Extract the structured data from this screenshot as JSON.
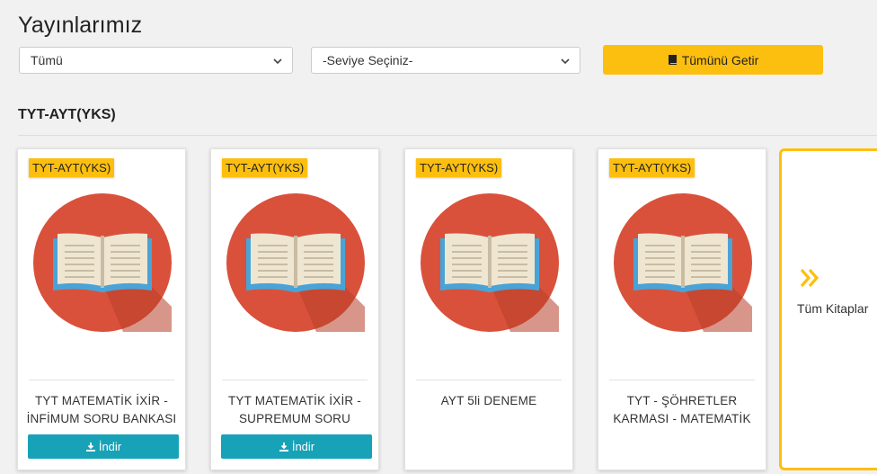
{
  "header": {
    "title": "Yayınlarımız"
  },
  "filters": {
    "category": "Tümü",
    "level": "-Seviye Seçiniz-",
    "fetch_label": "Tümünü Getir"
  },
  "section": {
    "title": "TYT-AYT(YKS)"
  },
  "books": [
    {
      "badge": "TYT-AYT(YKS)",
      "line1": "TYT MATEMATİK İXİR -",
      "line2": "İNFİMUM SORU BANKASI",
      "download": "İndir"
    },
    {
      "badge": "TYT-AYT(YKS)",
      "line1": "TYT MATEMATİK İXİR -",
      "line2": "SUPREMUM SORU",
      "download": "İndir"
    },
    {
      "badge": "TYT-AYT(YKS)",
      "line1": "AYT 5li DENEME",
      "line2": "",
      "download": ""
    },
    {
      "badge": "TYT-AYT(YKS)",
      "line1": "TYT - ŞÖHRETLER",
      "line2": "KARMASI - MATEMATİK",
      "download": ""
    }
  ],
  "all_books": {
    "label": "Tüm Kitaplar"
  },
  "colors": {
    "accent": "#fdbf0f",
    "download": "#17a2b8",
    "cover": "#d9513b"
  }
}
